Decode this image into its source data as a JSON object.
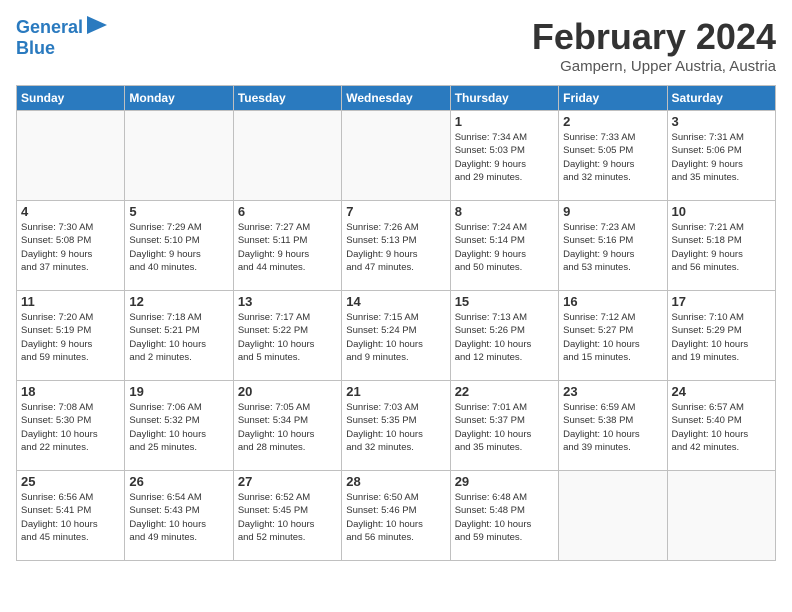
{
  "header": {
    "logo_line1": "General",
    "logo_line2": "Blue",
    "month": "February 2024",
    "location": "Gampern, Upper Austria, Austria"
  },
  "weekdays": [
    "Sunday",
    "Monday",
    "Tuesday",
    "Wednesday",
    "Thursday",
    "Friday",
    "Saturday"
  ],
  "weeks": [
    [
      {
        "day": "",
        "info": ""
      },
      {
        "day": "",
        "info": ""
      },
      {
        "day": "",
        "info": ""
      },
      {
        "day": "",
        "info": ""
      },
      {
        "day": "1",
        "info": "Sunrise: 7:34 AM\nSunset: 5:03 PM\nDaylight: 9 hours\nand 29 minutes."
      },
      {
        "day": "2",
        "info": "Sunrise: 7:33 AM\nSunset: 5:05 PM\nDaylight: 9 hours\nand 32 minutes."
      },
      {
        "day": "3",
        "info": "Sunrise: 7:31 AM\nSunset: 5:06 PM\nDaylight: 9 hours\nand 35 minutes."
      }
    ],
    [
      {
        "day": "4",
        "info": "Sunrise: 7:30 AM\nSunset: 5:08 PM\nDaylight: 9 hours\nand 37 minutes."
      },
      {
        "day": "5",
        "info": "Sunrise: 7:29 AM\nSunset: 5:10 PM\nDaylight: 9 hours\nand 40 minutes."
      },
      {
        "day": "6",
        "info": "Sunrise: 7:27 AM\nSunset: 5:11 PM\nDaylight: 9 hours\nand 44 minutes."
      },
      {
        "day": "7",
        "info": "Sunrise: 7:26 AM\nSunset: 5:13 PM\nDaylight: 9 hours\nand 47 minutes."
      },
      {
        "day": "8",
        "info": "Sunrise: 7:24 AM\nSunset: 5:14 PM\nDaylight: 9 hours\nand 50 minutes."
      },
      {
        "day": "9",
        "info": "Sunrise: 7:23 AM\nSunset: 5:16 PM\nDaylight: 9 hours\nand 53 minutes."
      },
      {
        "day": "10",
        "info": "Sunrise: 7:21 AM\nSunset: 5:18 PM\nDaylight: 9 hours\nand 56 minutes."
      }
    ],
    [
      {
        "day": "11",
        "info": "Sunrise: 7:20 AM\nSunset: 5:19 PM\nDaylight: 9 hours\nand 59 minutes."
      },
      {
        "day": "12",
        "info": "Sunrise: 7:18 AM\nSunset: 5:21 PM\nDaylight: 10 hours\nand 2 minutes."
      },
      {
        "day": "13",
        "info": "Sunrise: 7:17 AM\nSunset: 5:22 PM\nDaylight: 10 hours\nand 5 minutes."
      },
      {
        "day": "14",
        "info": "Sunrise: 7:15 AM\nSunset: 5:24 PM\nDaylight: 10 hours\nand 9 minutes."
      },
      {
        "day": "15",
        "info": "Sunrise: 7:13 AM\nSunset: 5:26 PM\nDaylight: 10 hours\nand 12 minutes."
      },
      {
        "day": "16",
        "info": "Sunrise: 7:12 AM\nSunset: 5:27 PM\nDaylight: 10 hours\nand 15 minutes."
      },
      {
        "day": "17",
        "info": "Sunrise: 7:10 AM\nSunset: 5:29 PM\nDaylight: 10 hours\nand 19 minutes."
      }
    ],
    [
      {
        "day": "18",
        "info": "Sunrise: 7:08 AM\nSunset: 5:30 PM\nDaylight: 10 hours\nand 22 minutes."
      },
      {
        "day": "19",
        "info": "Sunrise: 7:06 AM\nSunset: 5:32 PM\nDaylight: 10 hours\nand 25 minutes."
      },
      {
        "day": "20",
        "info": "Sunrise: 7:05 AM\nSunset: 5:34 PM\nDaylight: 10 hours\nand 28 minutes."
      },
      {
        "day": "21",
        "info": "Sunrise: 7:03 AM\nSunset: 5:35 PM\nDaylight: 10 hours\nand 32 minutes."
      },
      {
        "day": "22",
        "info": "Sunrise: 7:01 AM\nSunset: 5:37 PM\nDaylight: 10 hours\nand 35 minutes."
      },
      {
        "day": "23",
        "info": "Sunrise: 6:59 AM\nSunset: 5:38 PM\nDaylight: 10 hours\nand 39 minutes."
      },
      {
        "day": "24",
        "info": "Sunrise: 6:57 AM\nSunset: 5:40 PM\nDaylight: 10 hours\nand 42 minutes."
      }
    ],
    [
      {
        "day": "25",
        "info": "Sunrise: 6:56 AM\nSunset: 5:41 PM\nDaylight: 10 hours\nand 45 minutes."
      },
      {
        "day": "26",
        "info": "Sunrise: 6:54 AM\nSunset: 5:43 PM\nDaylight: 10 hours\nand 49 minutes."
      },
      {
        "day": "27",
        "info": "Sunrise: 6:52 AM\nSunset: 5:45 PM\nDaylight: 10 hours\nand 52 minutes."
      },
      {
        "day": "28",
        "info": "Sunrise: 6:50 AM\nSunset: 5:46 PM\nDaylight: 10 hours\nand 56 minutes."
      },
      {
        "day": "29",
        "info": "Sunrise: 6:48 AM\nSunset: 5:48 PM\nDaylight: 10 hours\nand 59 minutes."
      },
      {
        "day": "",
        "info": ""
      },
      {
        "day": "",
        "info": ""
      }
    ]
  ]
}
